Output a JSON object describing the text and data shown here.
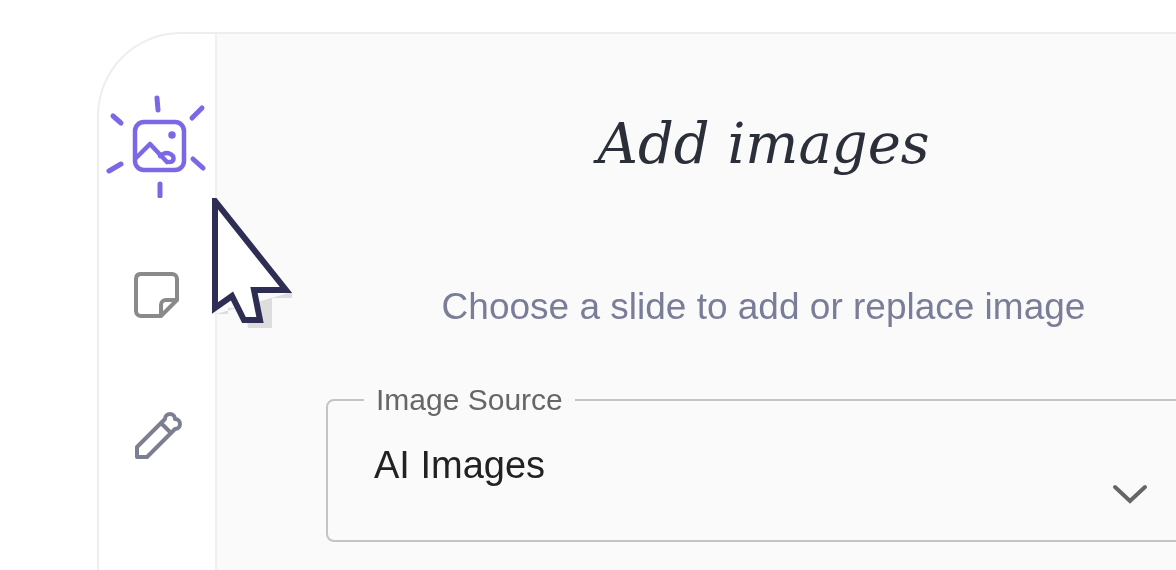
{
  "sidebar": {
    "items": [
      {
        "kind": "image",
        "selected": true
      },
      {
        "kind": "note",
        "selected": false
      },
      {
        "kind": "pencil",
        "selected": false
      }
    ]
  },
  "title": "Add images",
  "subtitle": "Choose a slide to add or replace image",
  "image_source": {
    "label": "Image Source",
    "value": "AI Images"
  }
}
